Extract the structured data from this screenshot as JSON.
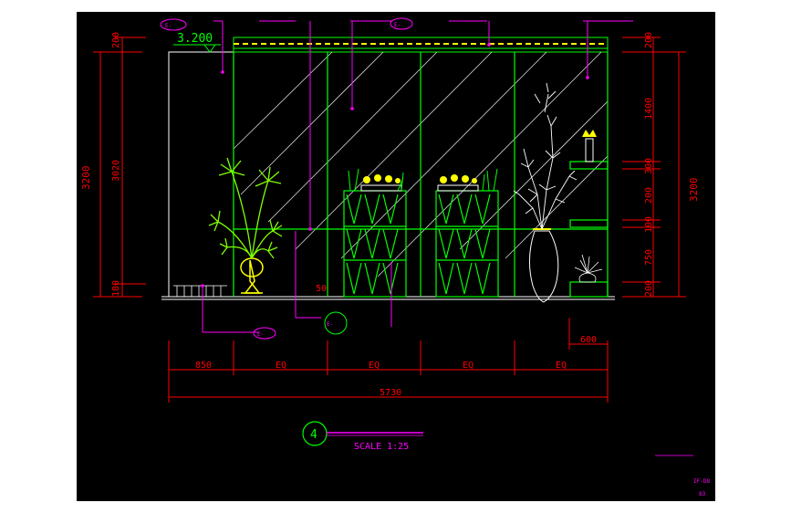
{
  "colors": {
    "background": "#000000",
    "dimension": "#ff0000",
    "panel": "#00ff00",
    "annotation": "#ff00ff",
    "outline": "#ffffff",
    "plant": "#ffff00",
    "note": "#ff00ff"
  },
  "elevation": {
    "level_mark": "3.200",
    "index_number": "4",
    "scale_text": "SCALE 1:25"
  },
  "dims_left": {
    "overall": "3200",
    "top": "200",
    "middle": "3020",
    "bottom": "180"
  },
  "dims_right": {
    "overall": "3200",
    "segments": [
      "200",
      "1400",
      "300",
      "200",
      "100",
      "750",
      "200"
    ]
  },
  "dims_bottom": {
    "segments": [
      "850",
      "EQ",
      "EQ",
      "EQ",
      "EQ"
    ],
    "overall": "5730",
    "cabinet_width": "600"
  },
  "dim_small": "50",
  "callouts": {
    "callout_1": "E-",
    "callout_2": "E-",
    "callout_3": "E-",
    "callout_4": "E-"
  },
  "sheet_code": "IF-D8",
  "sheet_page": "83"
}
